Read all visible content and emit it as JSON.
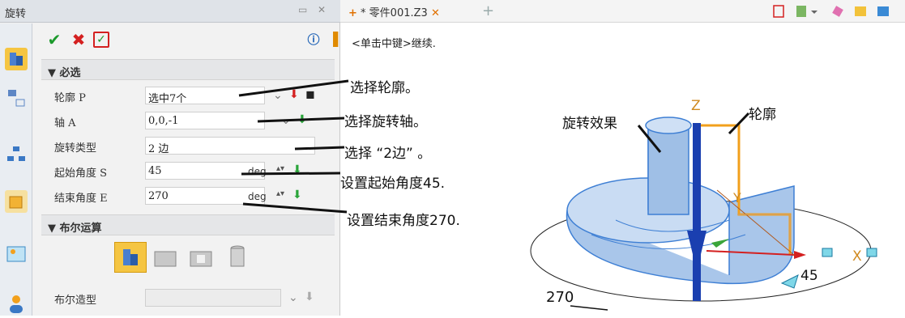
{
  "panel": {
    "title": "旋转",
    "sections": {
      "required": "▼ 必选",
      "boolean": "▼ 布尔运算"
    },
    "fields": [
      {
        "label": "轮廓 P",
        "value": "选中7个"
      },
      {
        "label": "轴 A",
        "value": "0,0,-1"
      },
      {
        "label": "旋转类型",
        "value": "2 边"
      },
      {
        "label": "起始角度 S",
        "value": "45",
        "unit": "deg"
      },
      {
        "label": "结束角度 E",
        "value": "270",
        "unit": "deg"
      }
    ],
    "boolean_field": {
      "label": "布尔造型",
      "value": ""
    }
  },
  "viewport": {
    "tab_label": "* 零件001.Z3",
    "hint": "<单击中键>继续."
  },
  "annotations": {
    "profile": "选择轮廓。",
    "axis": "选择旋转轴。",
    "type": "选择 “2边” 。",
    "start": "设置起始角度45.",
    "end": "设置结束角度270.",
    "effect": "旋转效果",
    "contour": "轮廓",
    "angle45": "45",
    "angle270": "270",
    "axis_z": "Z",
    "axis_y": "Y",
    "axis_x": "X"
  },
  "colors": {
    "accent_orange": "#f2a01c",
    "solid_blue": "#8fb8e6",
    "axis_blue": "#1a3fb0"
  }
}
